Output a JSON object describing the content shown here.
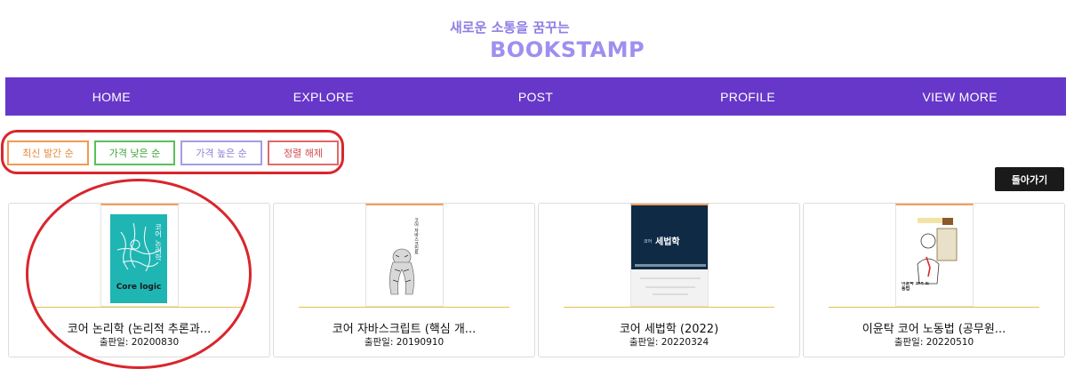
{
  "brand": {
    "tagline": "새로운 소통을 꿈꾸는",
    "name": "BOOKSTAMP"
  },
  "nav": {
    "items": [
      "HOME",
      "EXPLORE",
      "POST",
      "PROFILE",
      "VIEW MORE"
    ]
  },
  "sort": {
    "latest": "최신 발간 순",
    "price_low": "가격 낮은 순",
    "price_high": "가격 높은 순",
    "reset": "정렬 해제"
  },
  "back_label": "돌아가기",
  "books": [
    {
      "title": "코어 논리학 (논리적 추론과...",
      "date": "출판일: 20200830",
      "cover_text": "Core logic",
      "cover_title": "코어 논리학"
    },
    {
      "title": "코어 자바스크립트 (핵심 개...",
      "date": "출판일: 20190910",
      "cover_title": "코어 자바스크립트"
    },
    {
      "title": "코어 세법학 (2022)",
      "date": "출판일: 20220324",
      "cover_title": "세법학",
      "cover_sub": "코어"
    },
    {
      "title": "이윤탁 코어 노동법 (공무원...",
      "date": "출판일: 20220510",
      "cover_title": "이윤탁 코어 노동법"
    }
  ],
  "colors": {
    "nav_bg": "#6637c9",
    "brand": "#a08ef0",
    "annotation": "#d9262c"
  }
}
